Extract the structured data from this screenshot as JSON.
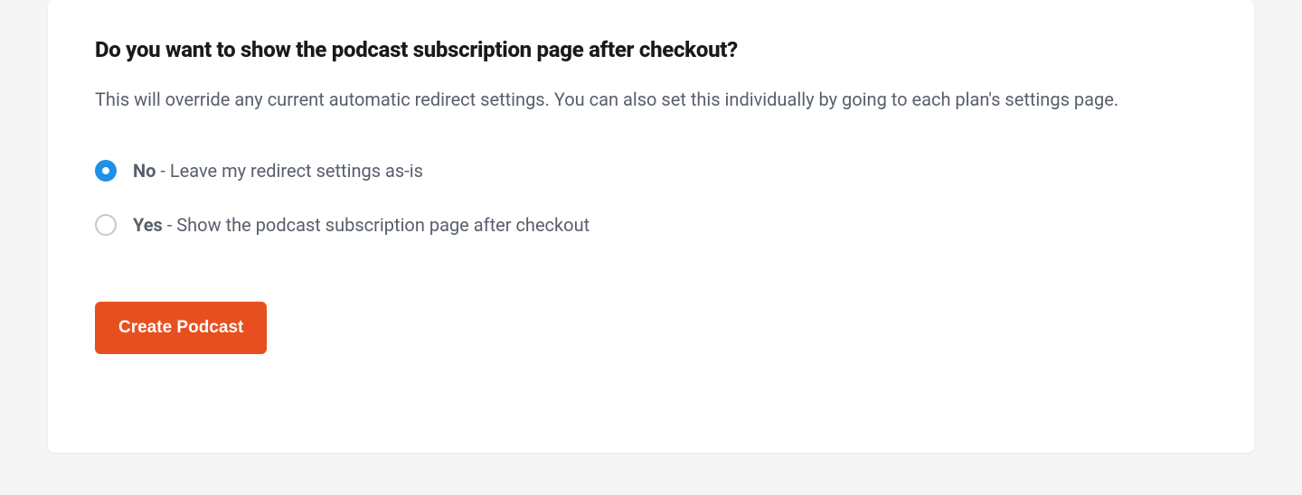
{
  "heading": "Do you want to show the podcast subscription page after checkout?",
  "description": "This will override any current automatic redirect settings. You can also set this individually by going to each plan's settings page.",
  "options": {
    "no": {
      "bold": "No",
      "rest": " - Leave my redirect settings as-is",
      "selected": true
    },
    "yes": {
      "bold": "Yes",
      "rest": " - Show the podcast subscription page after checkout",
      "selected": false
    }
  },
  "button": {
    "label": "Create Podcast"
  }
}
